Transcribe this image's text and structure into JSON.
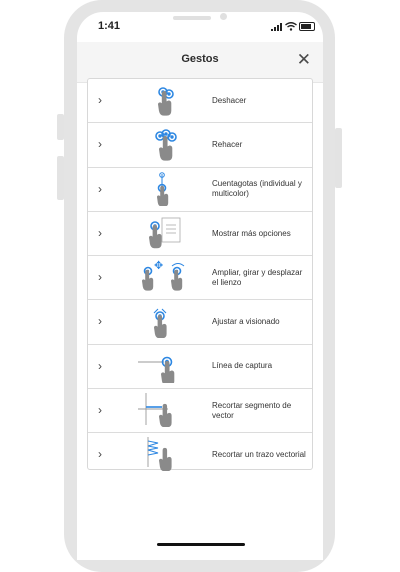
{
  "status_bar": {
    "time": "1:41"
  },
  "header": {
    "title": "Gestos",
    "close_icon": "close-icon"
  },
  "gestures": [
    {
      "label": "Deshacer",
      "icon": "two-finger-tap-icon"
    },
    {
      "label": "Rehacer",
      "icon": "three-finger-tap-icon"
    },
    {
      "label": "Cuentagotas (individual y multicolor)",
      "icon": "eyedropper-gesture-icon"
    },
    {
      "label": "Mostrar más opciones",
      "icon": "more-options-gesture-icon"
    },
    {
      "label": "Ampliar, girar y desplazar el lienzo",
      "icon": "zoom-rotate-pan-icon"
    },
    {
      "label": "Ajustar a visionado",
      "icon": "fit-to-view-icon"
    },
    {
      "label": "Línea de captura",
      "icon": "capture-line-icon"
    },
    {
      "label": "Recortar segmento de vector",
      "icon": "trim-vector-segment-icon"
    },
    {
      "label": "Recortar un trazo vectorial",
      "icon": "trim-vector-stroke-icon"
    }
  ],
  "colors": {
    "accent_blue": "#2d87e2",
    "hand_gray": "#8a8a8a"
  }
}
